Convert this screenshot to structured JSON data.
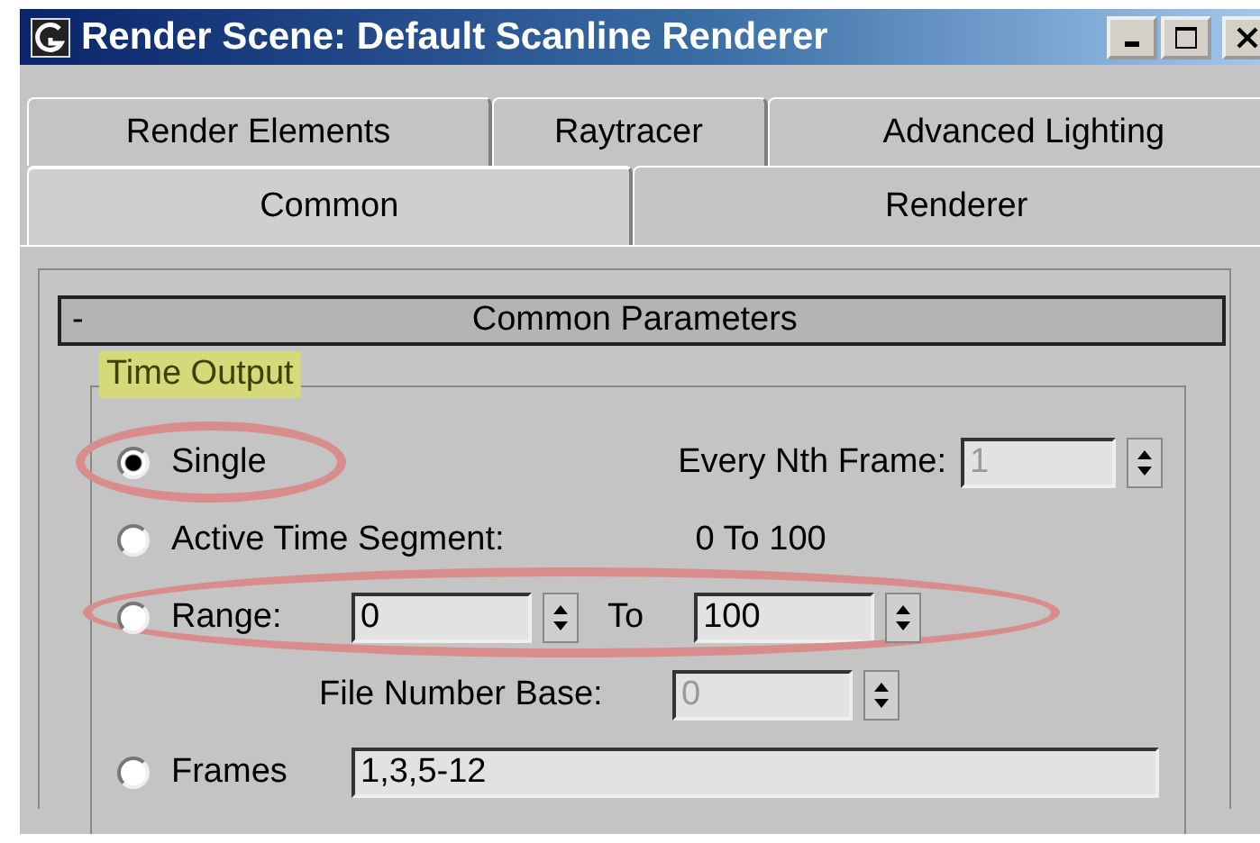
{
  "window": {
    "title": "Render Scene: Default Scanline Renderer"
  },
  "tab_rows": [
    [
      {
        "label": "Render Elements",
        "selected": false
      },
      {
        "label": "Raytracer",
        "selected": false
      },
      {
        "label": "Advanced Lighting",
        "selected": false
      }
    ],
    [
      {
        "label": "Common",
        "selected": true
      },
      {
        "label": "Renderer",
        "selected": false
      }
    ]
  ],
  "rollout": {
    "toggle": "-",
    "title": "Common Parameters"
  },
  "group": {
    "title": "Time Output",
    "highlighted": true
  },
  "options": [
    {
      "kind": "single",
      "label": "Single",
      "selected": true,
      "circled": true,
      "field_label": "Every Nth Frame:",
      "value": "1",
      "disabled": true
    },
    {
      "kind": "segment",
      "label": "Active Time Segment:",
      "selected": false,
      "circled": false,
      "value": "0 To 100"
    },
    {
      "kind": "range",
      "label": "Range:",
      "selected": false,
      "circled": true,
      "from": "0",
      "to_label": "To",
      "to": "100"
    },
    {
      "kind": "frames",
      "label": "Frames",
      "selected": false,
      "circled": false,
      "value": "1,3,5-12"
    }
  ],
  "file_number_base": {
    "label": "File Number Base:",
    "value": "0",
    "disabled": true
  }
}
